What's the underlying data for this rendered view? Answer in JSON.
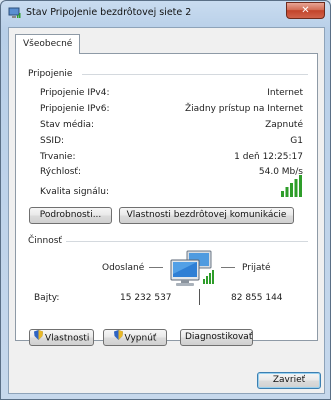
{
  "window": {
    "title": "Stav Pripojenie bezdrôtovej siete 2",
    "close_symbol": "✕"
  },
  "tabs": [
    {
      "label": "Všeobecné"
    }
  ],
  "connection": {
    "heading": "Pripojenie",
    "rows": [
      {
        "label": "Pripojenie IPv4:",
        "value": "Internet"
      },
      {
        "label": "Pripojenie IPv6:",
        "value": "Žiadny prístup na Internet"
      },
      {
        "label": "Stav média:",
        "value": "Zapnuté"
      },
      {
        "label": "SSID:",
        "value": "G1"
      },
      {
        "label": "Trvanie:",
        "value": "1 deň 12:25:17"
      },
      {
        "label": "Rýchlosť:",
        "value": "54.0 Mb/s"
      }
    ],
    "signal_label": "Kvalita signálu:",
    "signal_bars_lit": 5,
    "signal_bars_total": 5,
    "details_button": "Podrobnosti...",
    "wireless_props_button": "Vlastnosti bezdrôtovej komunikácie"
  },
  "activity": {
    "heading": "Činnosť",
    "sent_label": "Odoslané",
    "received_label": "Prijaté",
    "bytes_label": "Bajty:",
    "bytes_sent": "15 232 537",
    "bytes_received": "82 855 144"
  },
  "bottom_buttons": {
    "properties": "Vlastnosti",
    "disable": "Vypnúť",
    "diagnose": "Diagnostikovať"
  },
  "footer": {
    "close_button": "Zavrieť"
  },
  "colors": {
    "signal_green": "#2e9d2a",
    "accent_blue": "#3c7fb1"
  },
  "icons": {
    "title": "wireless-network-icon",
    "shield": "uac-shield-icon",
    "activity": "network-computers-icon"
  }
}
